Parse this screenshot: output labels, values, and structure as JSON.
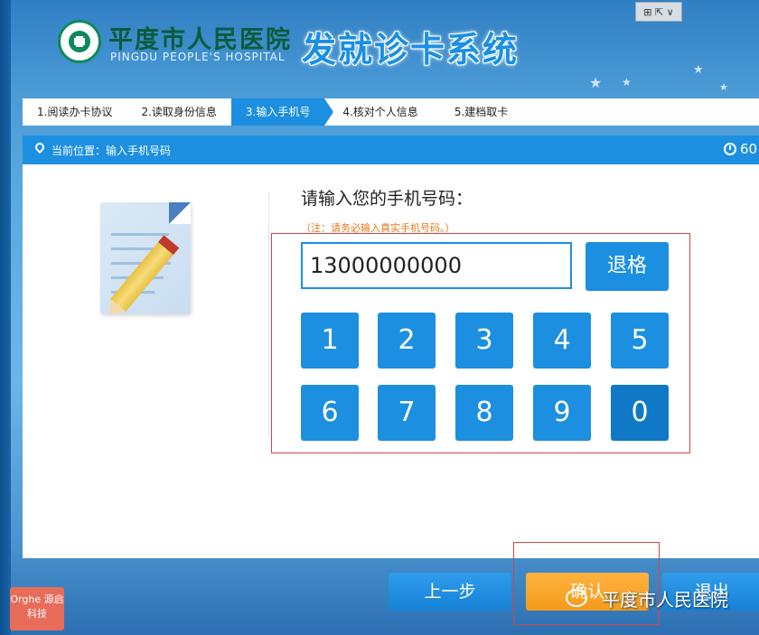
{
  "header": {
    "hospital_name": "平度市人民医院",
    "hospital_en": "PINGDU PEOPLE'S HOSPITAL",
    "system_title": "发就诊卡系统",
    "window_controls": "⊞ ⇱ ∨"
  },
  "steps": [
    {
      "label": "1.阅读办卡协议"
    },
    {
      "label": "2.读取身份信息"
    },
    {
      "label": "3.输入手机号"
    },
    {
      "label": "4.核对个人信息"
    },
    {
      "label": "5.建档取卡"
    }
  ],
  "location": {
    "label": "当前位置：输入手机号码",
    "timer": "60"
  },
  "form": {
    "prompt": "请输入您的手机号码：",
    "notice": "（注：请务必输入真实手机号码。）",
    "phone_value": "13000000000",
    "backspace_label": "退格"
  },
  "keypad": [
    "1",
    "2",
    "3",
    "4",
    "5",
    "6",
    "7",
    "8",
    "9",
    "0"
  ],
  "footer": {
    "prev_label": "上一步",
    "confirm_label": "确认",
    "exit_label": "退出",
    "watermark": "平度市人民医院",
    "brand": "Orghe 源启科技"
  },
  "colors": {
    "accent": "#1c8fe0",
    "confirm": "#f39a1c",
    "notice": "#e07a1c"
  }
}
